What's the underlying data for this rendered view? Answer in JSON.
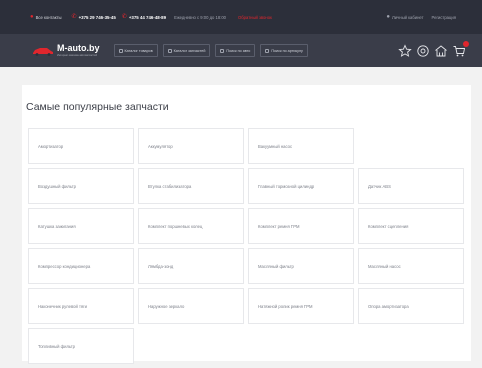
{
  "topbar": {
    "city": "Все контакты",
    "phone1": "+375 29 746-35-45",
    "phone2": "+375 44 746-48-89",
    "hours": "Ежедневно с 9:00 до 18:00",
    "link_red": "Обратный звонок",
    "login": "Личный кабинет",
    "register": "Регистрация"
  },
  "nav": {
    "logo_name": "M-auto.by",
    "logo_tag": "Интернет-магазин автозапчастей",
    "buttons": [
      "Каталог товаров",
      "Каталог запчастей",
      "Поиск по авто",
      "Поиск по артикулу"
    ]
  },
  "main": {
    "heading": "Самые популярные запчасти",
    "rows": [
      [
        "Амортизатор",
        "Аккумулятор",
        "Вакуумный насос"
      ],
      [
        "Воздушный фильтр",
        "Втулка стабилизатора",
        "Главный тормозной цилиндр",
        "Датчик ABS"
      ],
      [
        "Катушка зажигания",
        "Комплект поршневых колец",
        "Комплект ремня ГРМ",
        "Комплект сцепления"
      ],
      [
        "Компрессор кондиционера",
        "Лямбда-зонд",
        "Масляный фильтр",
        "Масляный насос"
      ],
      [
        "Наконечник рулевой тяги",
        "Наружное зеркало",
        "Натяжной ролик ремня ГРМ",
        "Опора амортизатора"
      ],
      [
        "Топливный фильтр"
      ]
    ]
  },
  "colors": {
    "accent": "#e0262d",
    "topbar_bg": "#2c2f3a",
    "navbar_bg": "#3a3d49",
    "page_bg": "#f2f2f2"
  },
  "icons": [
    "location-icon",
    "phone-icon",
    "user-icon",
    "car-logo-icon",
    "catalog-icon",
    "star-icon",
    "garage-icon",
    "home-icon",
    "cart-icon"
  ]
}
